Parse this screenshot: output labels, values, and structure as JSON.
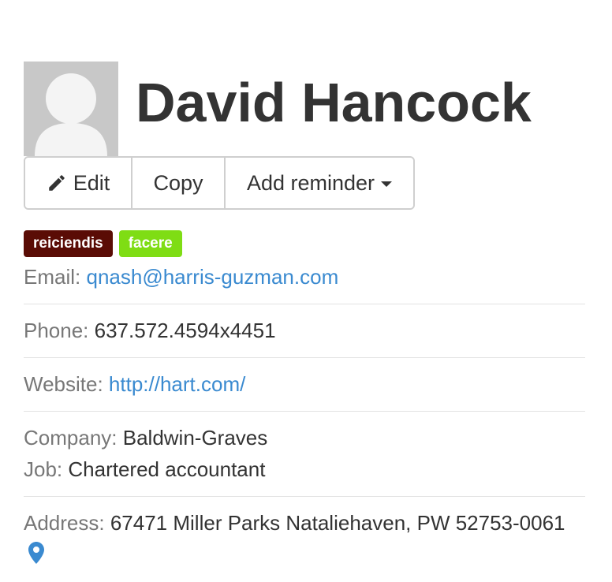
{
  "contact": {
    "name": "David Hancock",
    "tags": [
      {
        "label": "reiciendis",
        "color": "#5a0c05"
      },
      {
        "label": "facere",
        "color": "#7fdd14"
      }
    ],
    "email_label": "Email:",
    "email": "qnash@harris-guzman.com",
    "phone_label": "Phone:",
    "phone": "637.572.4594x4451",
    "website_label": "Website:",
    "website": "http://hart.com/",
    "company_label": "Company:",
    "company": "Baldwin-Graves",
    "job_label": "Job:",
    "job": "Chartered accountant",
    "address_label": "Address:",
    "address": "67471 Miller Parks Nataliehaven, PW 52753-0061"
  },
  "toolbar": {
    "edit_label": "Edit",
    "copy_label": "Copy",
    "reminder_label": "Add reminder"
  },
  "icons": {
    "edit": "pencil-icon",
    "reminder": "caret-down-icon",
    "address": "map-marker-icon",
    "avatar": "user-silhouette"
  },
  "colors": {
    "link": "#3a8ad0",
    "label": "#777777",
    "text": "#333333"
  }
}
